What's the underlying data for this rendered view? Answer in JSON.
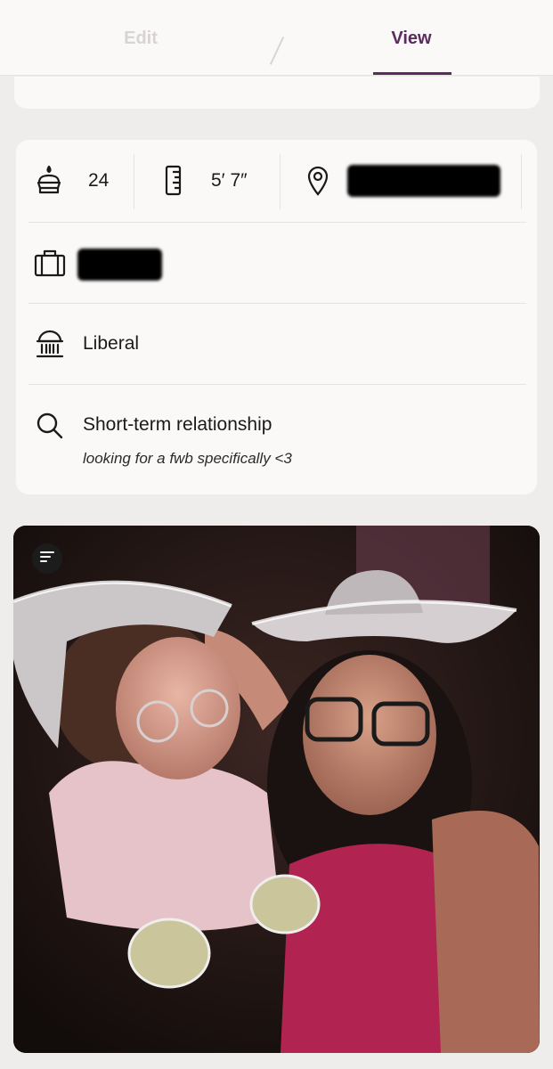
{
  "tabs": {
    "edit": "Edit",
    "view": "View",
    "active": "view"
  },
  "vitals": {
    "age": "24",
    "height": "5′ 7″",
    "location_redacted": true
  },
  "job": {
    "redacted": true
  },
  "politics": {
    "label": "Liberal"
  },
  "looking_for": {
    "label": "Short-term relationship",
    "note": "looking for a fwb specifically <3"
  },
  "icons": {
    "age": "birthday-cake-icon",
    "height": "ruler-icon",
    "location": "location-pin-icon",
    "job": "briefcase-icon",
    "politics": "government-building-icon",
    "looking_for": "search-icon",
    "photo_prompt": "text-lines-icon"
  },
  "colors": {
    "accent": "#5b2a5e",
    "inactive_tab": "#d7d4d3",
    "background": "#efedec",
    "card": "#faf9f8"
  }
}
